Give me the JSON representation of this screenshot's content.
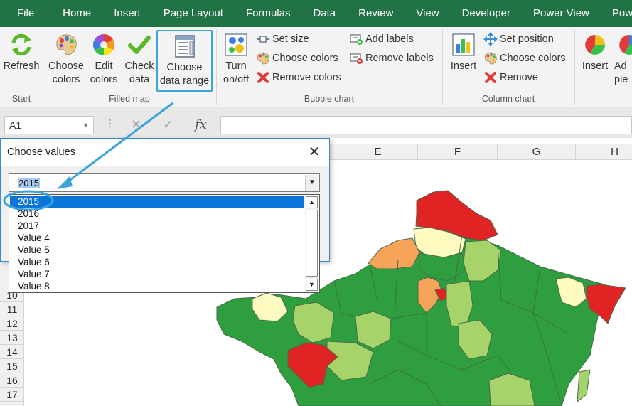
{
  "tabs": [
    "File",
    "Home",
    "Insert",
    "Page Layout",
    "Formulas",
    "Data",
    "Review",
    "View",
    "Developer",
    "Power View",
    "Power BI"
  ],
  "ribbon": {
    "groups": {
      "start": "Start",
      "filled_map": "Filled map",
      "bubble_chart": "Bubble chart",
      "column_chart": "Column chart"
    },
    "buttons": {
      "refresh": "Refresh",
      "choose_colors_1": "Choose",
      "choose_colors_2": "colors",
      "edit_colors_1": "Edit",
      "edit_colors_2": "colors",
      "check_data_1": "Check",
      "check_data_2": "data",
      "choose_range_1": "Choose",
      "choose_range_2": "data range",
      "turn_onoff_1": "Turn",
      "turn_onoff_2": "on/off",
      "set_size": "Set size",
      "bubble_choose_colors": "Choose colors",
      "bubble_remove_colors": "Remove colors",
      "add_labels": "Add labels",
      "remove_labels": "Remove labels",
      "column_insert": "Insert",
      "set_position": "Set position",
      "column_choose_colors": "Choose colors",
      "column_remove": "Remove",
      "pie_insert": "Insert",
      "pie_add_1": "Ad",
      "pie_add_2": "pie"
    }
  },
  "formula_bar": {
    "name_box": "A1",
    "fx": "fx"
  },
  "sheet": {
    "columns": [
      "E",
      "F",
      "G",
      "H"
    ],
    "rows": [
      "10",
      "11",
      "12",
      "13",
      "14",
      "15",
      "16",
      "17"
    ]
  },
  "dialog": {
    "title": "Choose values",
    "selected": "2015",
    "options": [
      "2015",
      "2016",
      "2017",
      "Value 4",
      "Value 5",
      "Value 6",
      "Value 7",
      "Value 8"
    ]
  },
  "colors": {
    "excel_green": "#217346",
    "accent_blue": "#3aa3db",
    "map_dark_green": "#2e9e3f",
    "map_light_green": "#a6d46a",
    "map_cream": "#fdfbc0",
    "map_orange": "#f6a45a",
    "map_red": "#e02424"
  }
}
